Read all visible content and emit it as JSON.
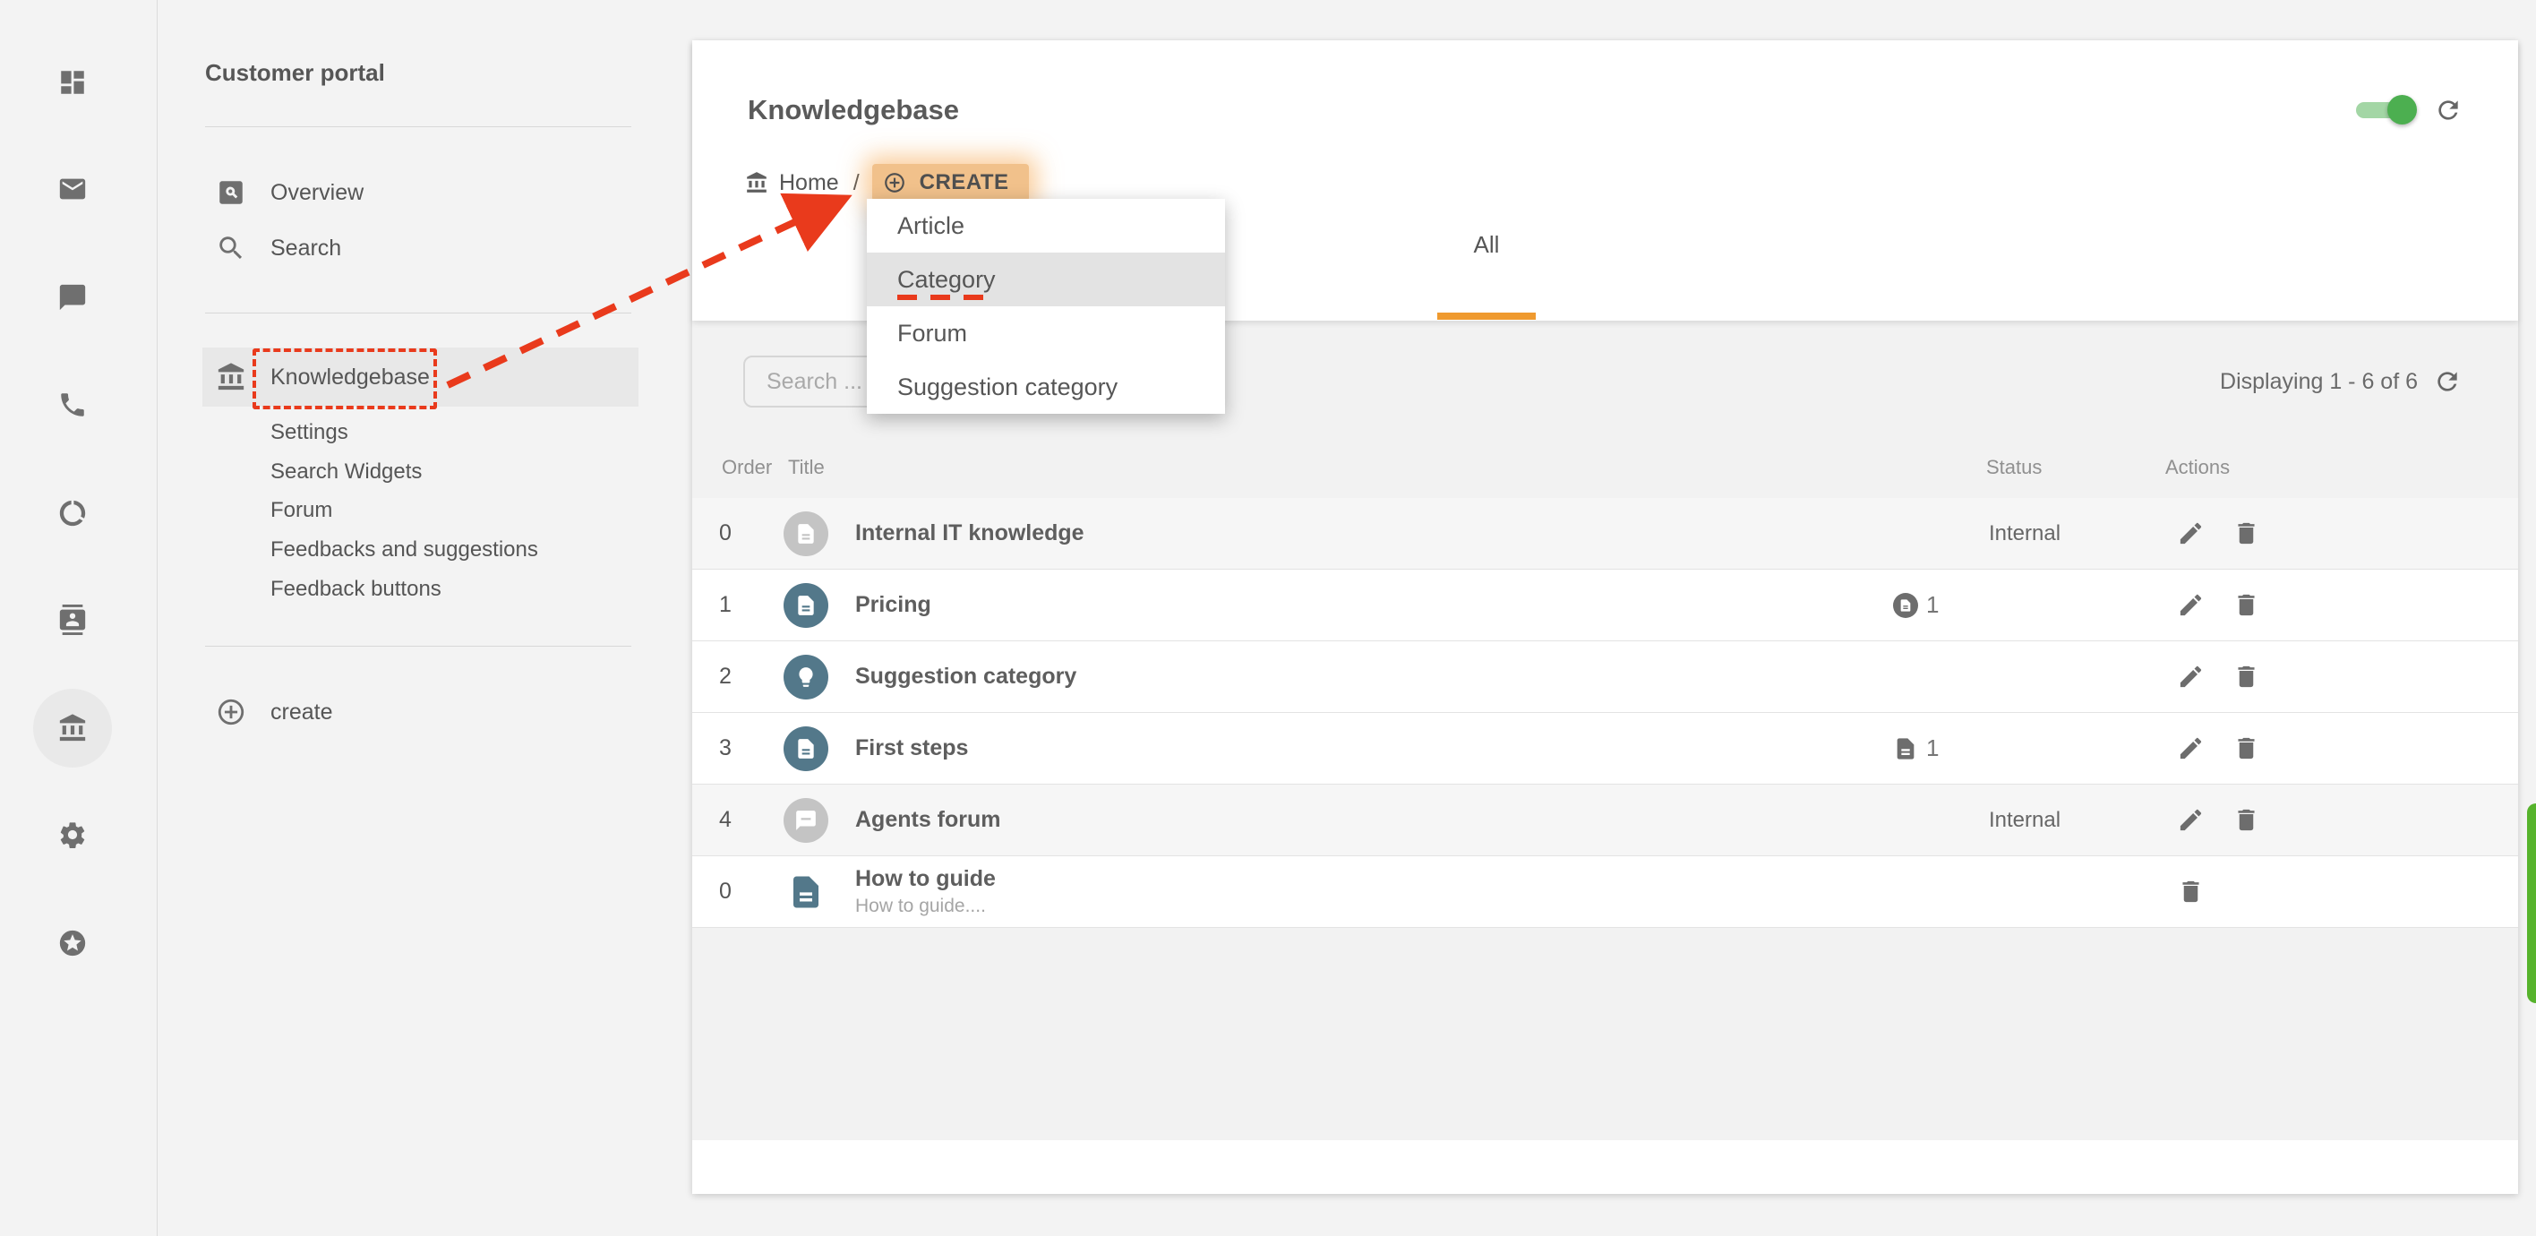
{
  "sidebar": {
    "icons": [
      {
        "name": "dashboard",
        "active": false
      },
      {
        "name": "email",
        "active": false
      },
      {
        "name": "chat",
        "active": false
      },
      {
        "name": "phone",
        "active": false
      },
      {
        "name": "data-usage",
        "active": false
      },
      {
        "name": "contacts",
        "active": false
      },
      {
        "name": "knowledgebase",
        "active": true
      },
      {
        "name": "settings",
        "active": false
      },
      {
        "name": "rewards",
        "active": false
      }
    ]
  },
  "nav": {
    "title": "Customer portal",
    "items": [
      {
        "icon": "pageview",
        "label": "Overview"
      },
      {
        "icon": "search",
        "label": "Search"
      }
    ],
    "knowledgebase": {
      "icon": "bank",
      "label": "Knowledgebase",
      "children": [
        "Settings",
        "Search Widgets",
        "Forum",
        "Feedbacks and suggestions",
        "Feedback buttons"
      ]
    },
    "create_label": "create"
  },
  "header": {
    "title": "Knowledgebase",
    "breadcrumb_home": "Home",
    "breadcrumb_separator": "/",
    "create_button": "CREATE"
  },
  "menu": {
    "items": [
      "Article",
      "Category",
      "Forum",
      "Suggestion category"
    ],
    "highlighted": "Category"
  },
  "tabs": {
    "all_label": "All"
  },
  "toolbar": {
    "search_placeholder": "Search ...",
    "displaying": "Displaying 1 - 6 of 6"
  },
  "table": {
    "headers": [
      "Order",
      "Title",
      "Status",
      "Actions"
    ],
    "rows": [
      {
        "order": "0",
        "title": "Internal IT knowledge",
        "subtitle": "",
        "avatar": "article",
        "avatar_color": "gray",
        "status_text": "Internal",
        "status_icon": "",
        "status_count": "",
        "actions": [
          "edit",
          "delete"
        ],
        "highlighted": true
      },
      {
        "order": "1",
        "title": "Pricing",
        "subtitle": "",
        "avatar": "article",
        "avatar_color": "teal",
        "status_text": "",
        "status_icon": "article-circle",
        "status_count": "1",
        "actions": [
          "edit",
          "delete"
        ],
        "highlighted": false
      },
      {
        "order": "2",
        "title": "Suggestion category",
        "subtitle": "",
        "avatar": "lightbulb",
        "avatar_color": "teal",
        "status_text": "",
        "status_icon": "",
        "status_count": "",
        "actions": [
          "edit",
          "delete"
        ],
        "highlighted": false
      },
      {
        "order": "3",
        "title": "First steps",
        "subtitle": "",
        "avatar": "article",
        "avatar_color": "teal",
        "status_text": "",
        "status_icon": "article",
        "status_count": "1",
        "actions": [
          "edit",
          "delete"
        ],
        "highlighted": false
      },
      {
        "order": "4",
        "title": "Agents forum",
        "subtitle": "",
        "avatar": "forum",
        "avatar_color": "gray",
        "status_text": "Internal",
        "status_icon": "",
        "status_count": "",
        "actions": [
          "edit",
          "delete"
        ],
        "highlighted": true
      },
      {
        "order": "0",
        "title": "How to guide",
        "subtitle": "How to guide....",
        "avatar": "article-plain",
        "avatar_color": "teal",
        "status_text": "",
        "status_icon": "",
        "status_count": "",
        "actions": [
          "delete"
        ],
        "highlighted": false
      }
    ]
  },
  "colors": {
    "accent_orange": "#ef9a2f",
    "annotation_red": "#e93a1c",
    "toggle_green": "#4caf50",
    "avatar_teal": "#53788a",
    "avatar_gray": "#c4c4c4",
    "create_chip_orange": "#f1c18b",
    "edge_button_green": "#56b32c"
  }
}
